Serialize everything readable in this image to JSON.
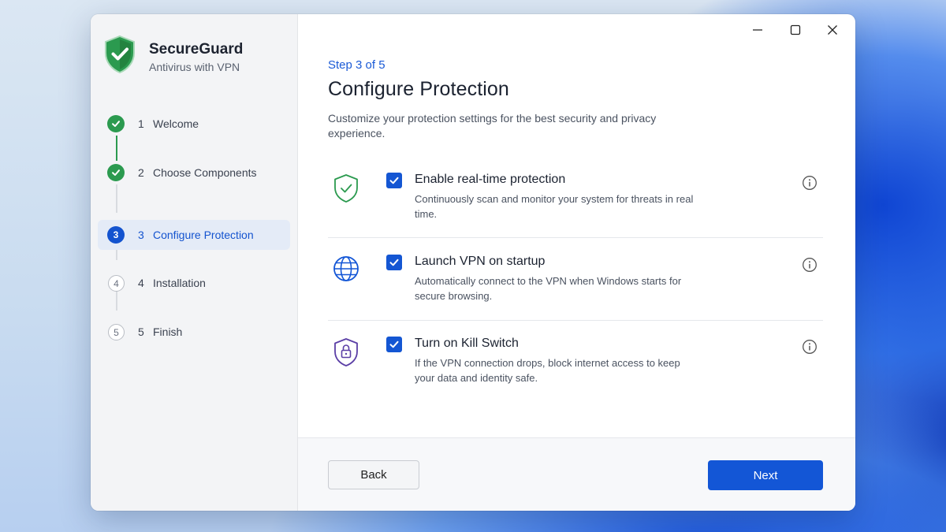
{
  "app": {
    "name": "SecureGuard",
    "subtitle": "Antivirus with VPN"
  },
  "steps": [
    {
      "number": "1",
      "label": "Welcome",
      "state": "done"
    },
    {
      "number": "2",
      "label": "Choose Components",
      "state": "done"
    },
    {
      "number": "3",
      "label": "Configure Protection",
      "state": "current"
    },
    {
      "number": "4",
      "label": "Installation",
      "state": "todo"
    },
    {
      "number": "5",
      "label": "Finish",
      "state": "todo"
    }
  ],
  "main": {
    "step_indicator": "Step 3 of 5",
    "title": "Configure Protection",
    "description": "Customize your protection settings for the best security and privacy experience.",
    "options": [
      {
        "icon": "shield-check-icon",
        "checked": true,
        "title": "Enable real-time protection",
        "description": "Continuously scan and monitor your system for threats in real time."
      },
      {
        "icon": "globe-icon",
        "checked": true,
        "title": "Launch VPN on startup",
        "description": "Automatically connect to the VPN when Windows starts for secure browsing."
      },
      {
        "icon": "shield-lock-icon",
        "checked": true,
        "title": "Turn on Kill Switch",
        "description": "If the VPN connection drops, block internet access to keep your data and identity safe."
      }
    ]
  },
  "footer": {
    "back_label": "Back",
    "next_label": "Next"
  },
  "colors": {
    "accent": "#1356d6",
    "success": "#2b9a4f",
    "kill_switch": "#5b3fa6"
  }
}
